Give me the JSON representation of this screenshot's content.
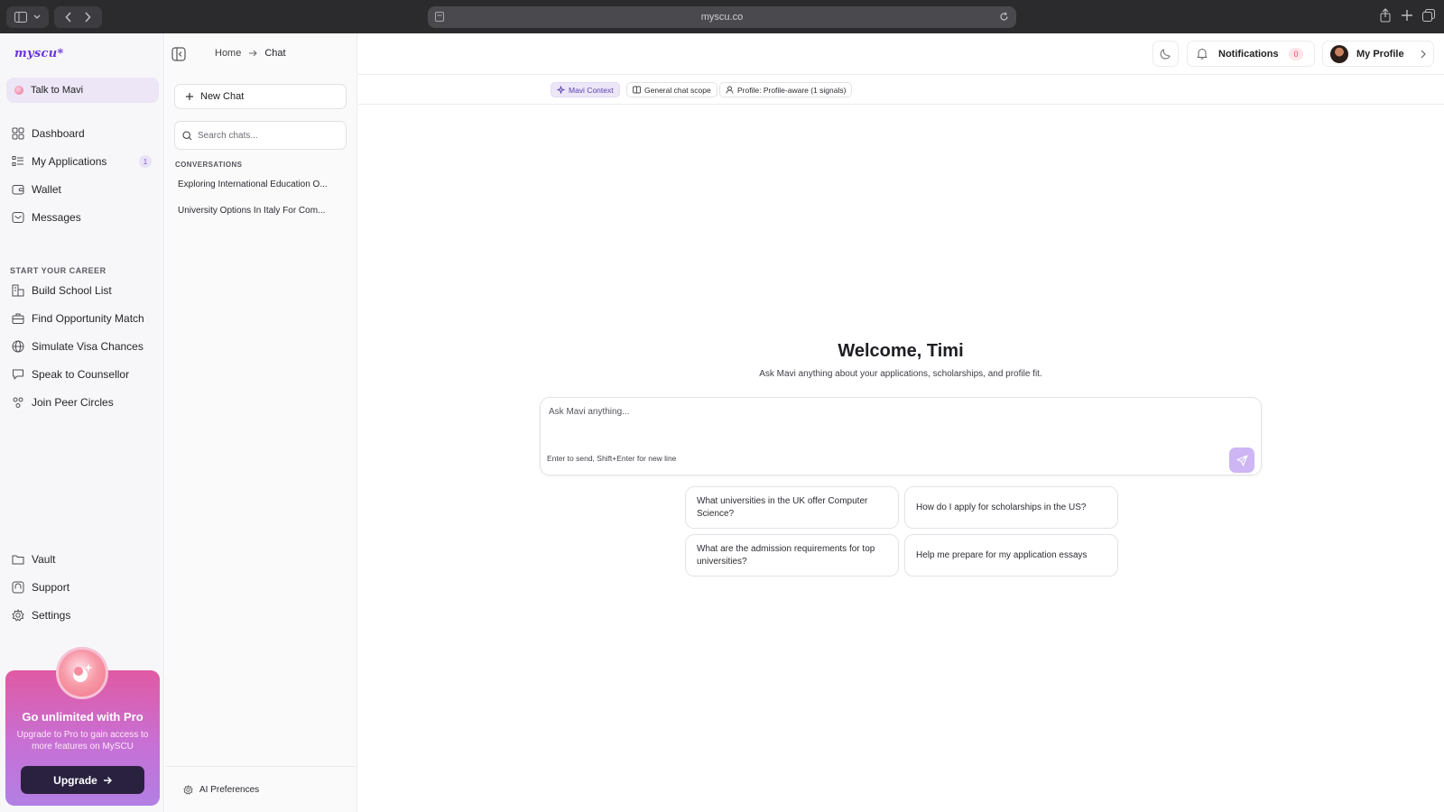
{
  "browser": {
    "url": "myscu.co"
  },
  "sidebar": {
    "logo": "myscu*",
    "talk_label": "Talk to Mavi",
    "main_items": [
      {
        "label": "Dashboard",
        "icon": "grid-icon"
      },
      {
        "label": "My Applications",
        "icon": "list-icon",
        "badge": "1"
      },
      {
        "label": "Wallet",
        "icon": "wallet-icon"
      },
      {
        "label": "Messages",
        "icon": "mail-icon"
      }
    ],
    "section_label": "START YOUR CAREER",
    "career_items": [
      {
        "label": "Build School List",
        "icon": "school-icon"
      },
      {
        "label": "Find Opportunity Match",
        "icon": "briefcase-icon"
      },
      {
        "label": "Simulate Visa Chances",
        "icon": "globe-icon"
      },
      {
        "label": "Speak to Counsellor",
        "icon": "chat-icon"
      },
      {
        "label": "Join Peer Circles",
        "icon": "people-icon"
      }
    ],
    "bottom_items": [
      {
        "label": "Vault",
        "icon": "folder-icon"
      },
      {
        "label": "Support",
        "icon": "support-icon"
      },
      {
        "label": "Settings",
        "icon": "gear-icon"
      }
    ],
    "promo": {
      "title": "Go unlimited with Pro",
      "text": "Upgrade to Pro to gain access to more features on MySCU",
      "button": "Upgrade"
    }
  },
  "panel": {
    "new_chat": "New Chat",
    "search_placeholder": "Search chats...",
    "conversations_label": "CONVERSATIONS",
    "conversations": [
      "Exploring International Education O...",
      "University Options In Italy For Com..."
    ],
    "ai_preferences": "AI Preferences"
  },
  "header": {
    "breadcrumb": [
      "Home",
      "Chat"
    ],
    "notifications_label": "Notifications",
    "notifications_count": "0",
    "profile_label": "My Profile"
  },
  "context_chips": [
    {
      "label": "Mavi Context",
      "active": true
    },
    {
      "label": "General chat scope",
      "active": false
    },
    {
      "label": "Profile: Profile-aware (1 signals)",
      "active": false
    }
  ],
  "main": {
    "welcome": "Welcome, Timi",
    "subtitle": "Ask Mavi anything about your applications, scholarships, and profile fit.",
    "input_placeholder": "Ask Mavi anything...",
    "hint": "Enter to send, Shift+Enter for new line",
    "suggestions": [
      "What universities in the UK offer Computer Science?",
      "How do I apply for scholarships in the US?",
      "What are the admission requirements for top universities?",
      "Help me prepare for my application essays"
    ]
  },
  "colors": {
    "accent": "#6b35d9",
    "send_button": "#cdb6f3",
    "promo_top": "#e05aa3",
    "promo_bottom": "#b27fe3"
  }
}
